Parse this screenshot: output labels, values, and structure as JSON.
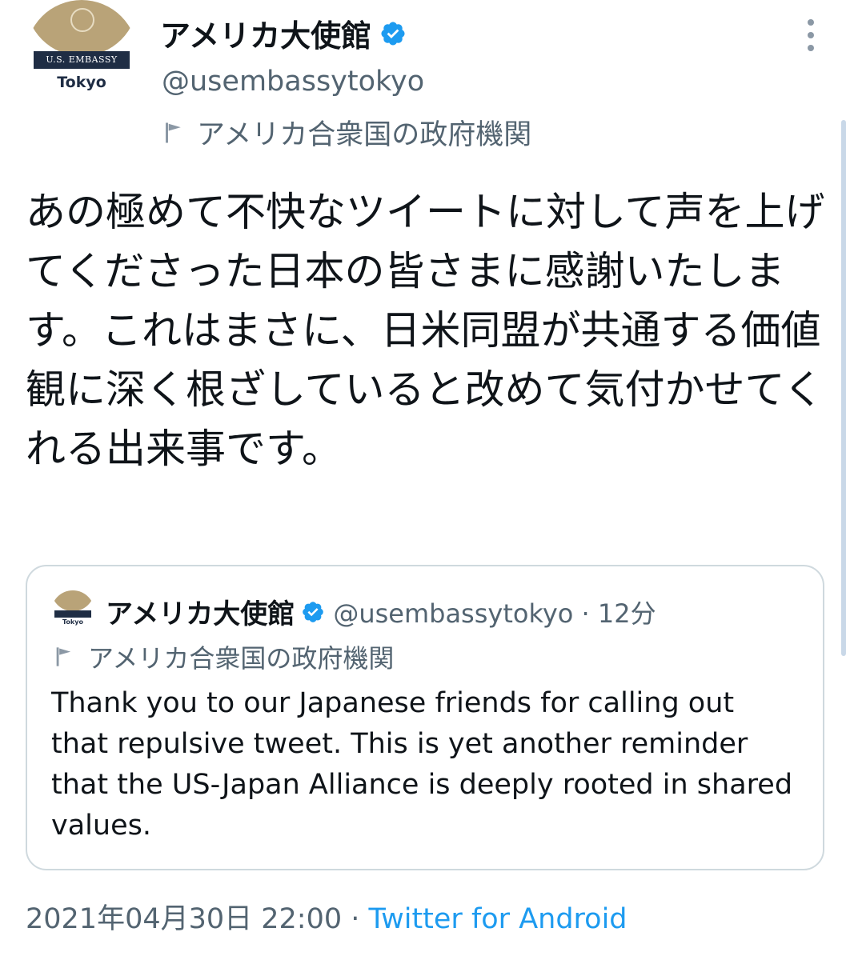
{
  "author": {
    "avatar_banner": "U.S. EMBASSY",
    "avatar_city": "Tokyo",
    "display_name": "アメリカ大使館",
    "handle": "@usembassytokyo",
    "label": "アメリカ合衆国の政府機関"
  },
  "tweet": {
    "text": "あの極めて不快なツイートに対して声を上げてくださった日本の皆さまに感謝いたします。これはまさに、日米同盟が共通する価値観に深く根ざしていると改めて気付かせてくれる出来事です。"
  },
  "quoted_tweet": {
    "display_name": "アメリカ大使館",
    "meta": "@usembassytokyo · 12分",
    "label": "アメリカ合衆国の政府機関",
    "text": "Thank you to our Japanese friends for calling out that repulsive tweet. This is yet another reminder that the US-Japan Alliance is deeply rooted in shared values.",
    "avatar_city": "Tokyo"
  },
  "footer": {
    "timestamp": "2021年04月30日 22:00 · ",
    "source": "Twitter for Android"
  },
  "colors": {
    "verified": "#1d9bf0",
    "secondary_text": "#536471",
    "link": "#1d9bf0",
    "border": "#cfd9de"
  },
  "icons": {
    "verified": "verified-badge-icon",
    "label": "flag-icon",
    "more": "more-options-icon"
  }
}
